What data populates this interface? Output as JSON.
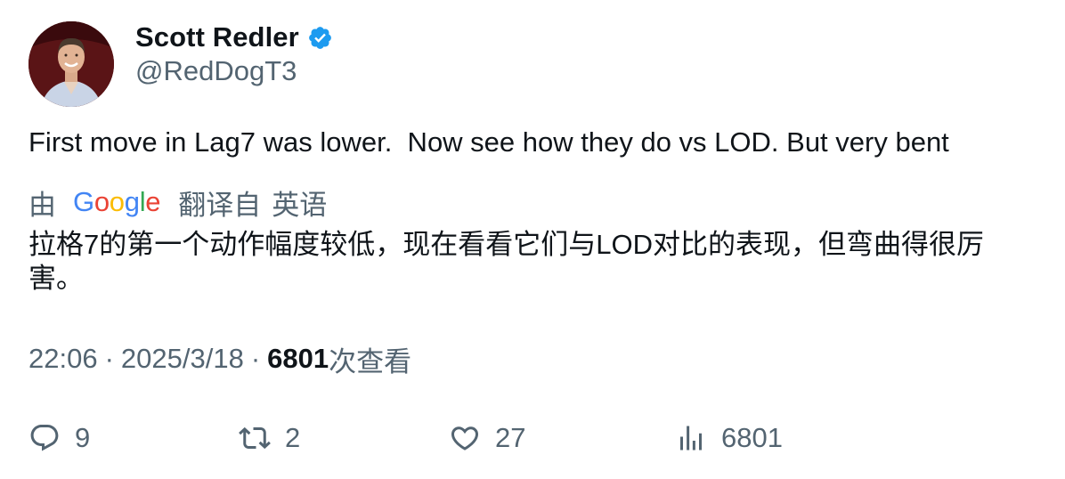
{
  "author": {
    "display_name": "Scott Redler",
    "handle": "@RedDogT3",
    "verified_icon": "verified-badge-icon",
    "avatar_icon": "profile-avatar"
  },
  "tweet": {
    "text": "First move in Lag7 was lower.  Now see how they do vs LOD. But very bent"
  },
  "translation": {
    "prefix": "由",
    "logo_text": "Google",
    "label": "翻译自",
    "language": "英语",
    "text": "拉格7的第一个动作幅度较低，现在看看它们与LOD对比的表现，但弯曲得很厉害。"
  },
  "meta": {
    "time": "22:06",
    "separator": "·",
    "date": "2025/3/18",
    "views_count": "6801",
    "views_label": "次查看"
  },
  "actions": {
    "replies": {
      "count": "9",
      "icon": "reply-icon"
    },
    "retweets": {
      "count": "2",
      "icon": "retweet-icon"
    },
    "likes": {
      "count": "27",
      "icon": "heart-icon"
    },
    "views": {
      "count": "6801",
      "icon": "analytics-icon"
    }
  },
  "colors": {
    "text_primary": "#0f1419",
    "text_secondary": "#536471",
    "verified_blue": "#1d9bf0"
  }
}
